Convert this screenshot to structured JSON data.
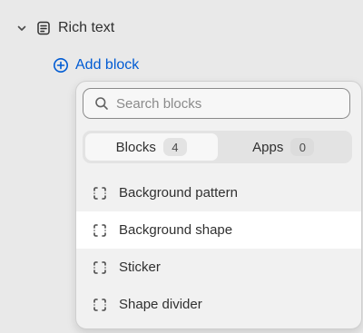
{
  "section": {
    "label": "Rich text",
    "chevron_icon": "chevron-down-icon",
    "icon": "text-document-icon"
  },
  "add_block": {
    "label": "Add block",
    "icon": "plus-circle-icon",
    "color": "#005bd3"
  },
  "popover": {
    "search": {
      "placeholder": "Search blocks",
      "value": ""
    },
    "tabs": [
      {
        "label": "Blocks",
        "count": "4",
        "active": true
      },
      {
        "label": "Apps",
        "count": "0",
        "active": false
      }
    ],
    "items": [
      {
        "label": "Background pattern",
        "icon": "dashed-block-icon",
        "highlighted": false
      },
      {
        "label": "Background shape",
        "icon": "dashed-block-icon",
        "highlighted": true
      },
      {
        "label": "Sticker",
        "icon": "dashed-block-icon",
        "highlighted": false
      },
      {
        "label": "Shape divider",
        "icon": "dashed-block-icon",
        "highlighted": false
      }
    ]
  }
}
